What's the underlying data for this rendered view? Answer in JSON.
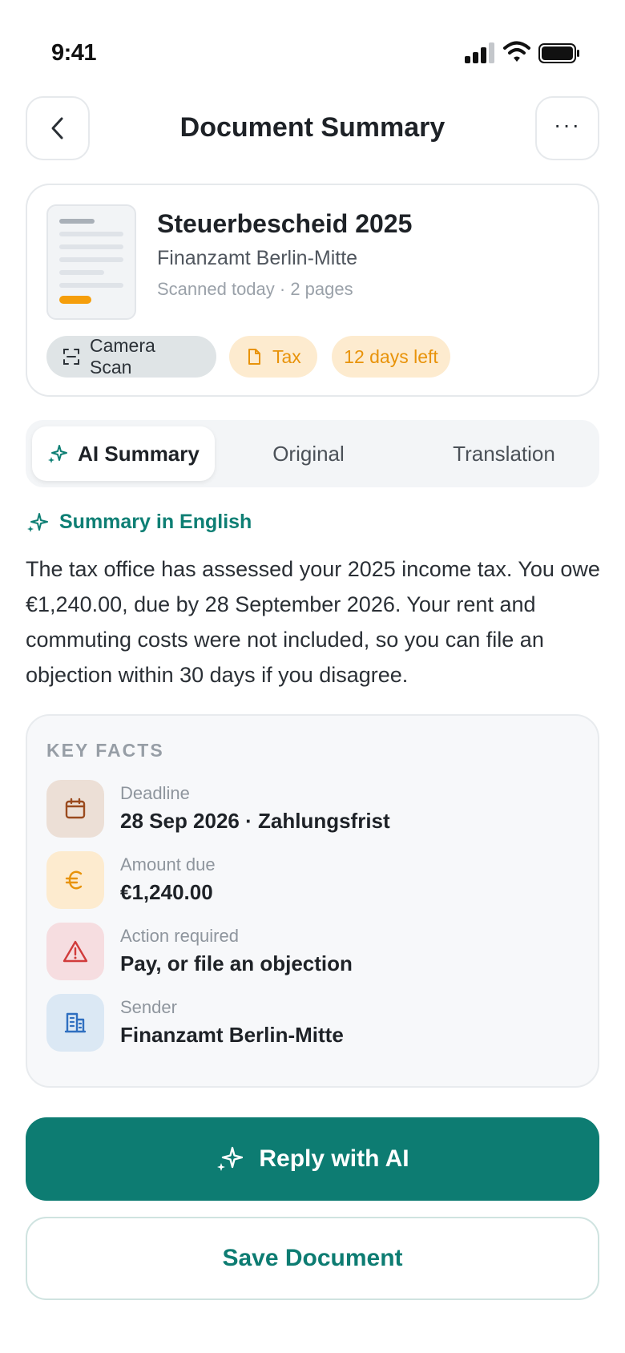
{
  "status_bar": {
    "time": "9:41"
  },
  "header": {
    "title": "Document Summary"
  },
  "document": {
    "title": "Steuerbescheid 2025",
    "sender": "Finanzamt Berlin-Mitte",
    "meta": "Scanned today · 2 pages",
    "chips": {
      "source": "Camera Scan",
      "category": "Tax",
      "deadline": "12 days left"
    }
  },
  "tabs": [
    {
      "label": "AI Summary",
      "active": true
    },
    {
      "label": "Original",
      "active": false
    },
    {
      "label": "Translation",
      "active": false
    }
  ],
  "summary": {
    "label": "Summary in English",
    "text": "The tax office has assessed your 2025 income tax. You owe €1,240.00, due by 28 September 2026. Your rent and commuting costs were not included, so you can file an objection within 30 days if you disagree."
  },
  "key_facts": {
    "title": "KEY FACTS",
    "items": [
      {
        "label": "Deadline",
        "value": "28 Sep 2026 · Zahlungsfrist",
        "icon": "calendar-icon"
      },
      {
        "label": "Amount due",
        "value": "€1,240.00",
        "icon": "euro-icon"
      },
      {
        "label": "Action required",
        "value": "Pay, or file an objection",
        "icon": "warning-icon"
      },
      {
        "label": "Sender",
        "value": "Finanzamt Berlin-Mitte",
        "icon": "building-icon"
      }
    ]
  },
  "actions": {
    "primary": "Reply with AI",
    "secondary": "Save Document"
  },
  "colors": {
    "accent": "#0d7c72",
    "warning": "#e8930a",
    "danger": "#d13b3b",
    "info": "#2f6fc0"
  }
}
